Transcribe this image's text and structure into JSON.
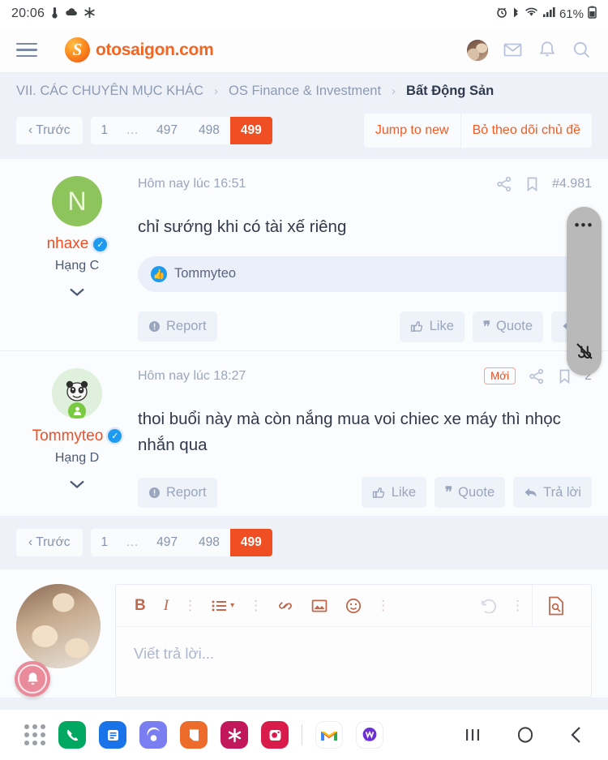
{
  "statusbar": {
    "clock": "20:06",
    "battery_pct": "61%",
    "left_icons": [
      "thermometer-icon",
      "cloud-icon",
      "snowflake-icon"
    ],
    "right_icons": [
      "alarm-icon",
      "bluetooth-icon",
      "wifi-icon",
      "signal-icon",
      "battery-icon"
    ]
  },
  "header": {
    "menu_icon": "hamburger-menu-icon",
    "logo_text": "otosaigon.com",
    "logo_mark": "otosaigon-logo-icon",
    "actions": [
      "user-avatar",
      "mail-icon",
      "bell-icon",
      "search-icon"
    ],
    "brand_color": "#f26522"
  },
  "breadcrumb": {
    "items": [
      {
        "label": "VII. CÁC CHUYÊN MỤC KHÁC",
        "current": false
      },
      {
        "label": "OS Finance & Investment",
        "current": false
      },
      {
        "label": "Bất Động Sản",
        "current": true
      }
    ],
    "separator": "›"
  },
  "pagination": {
    "prev_label": "‹ Trước",
    "pages": [
      "1",
      "…",
      "497",
      "498",
      "499"
    ],
    "active_page": "499",
    "active_color": "#f04e23",
    "actions": [
      {
        "label": "Jump to new",
        "name": "jump-to-new-button"
      },
      {
        "label": "Bỏ theo dõi chủ đề",
        "name": "unwatch-thread-button"
      }
    ]
  },
  "posts": [
    {
      "username": "nhaxe",
      "rank": "Hạng C",
      "avatar_letter": "N",
      "avatar_type": "letter-avatar",
      "avatar_color": "#8ec45c",
      "verified": true,
      "timestamp": "Hôm nay lúc 16:51",
      "post_number": "#4.981",
      "new_badge": "",
      "text": "chỉ sướng khi có tài xế riêng",
      "reaction_names": "Tommyteo",
      "reaction_icon": "thumbs-up-icon",
      "meta_icons": [
        "share-icon",
        "bookmark-icon"
      ],
      "actions": {
        "report": "Report",
        "like": "Like",
        "quote": "Quote",
        "reply": ""
      }
    },
    {
      "username": "Tommyteo",
      "rank": "Hạng D",
      "avatar_letter": "",
      "avatar_type": "panda-photo-avatar",
      "avatar_color": "#dff0dc",
      "verified": true,
      "timestamp": "Hôm nay lúc 18:27",
      "post_number": "2",
      "new_badge": "Mới",
      "text": "thoi buổi này mà còn nắng mua voi chiec xe máy thì nhọc nhắn qua",
      "reaction_names": "",
      "reaction_icon": "",
      "meta_icons": [
        "share-icon",
        "bookmark-icon"
      ],
      "actions": {
        "report": "Report",
        "like": "Like",
        "quote": "Quote",
        "reply": "Trả lời"
      }
    }
  ],
  "editor": {
    "avatar": "puppies-photo-avatar",
    "placeholder": "Viết trả lời...",
    "toolbar": [
      {
        "label": "B",
        "name": "bold-button"
      },
      {
        "label": "I",
        "name": "italic-button"
      },
      {
        "label": "⋮",
        "name": "more-text-options-icon"
      },
      {
        "label": "list",
        "name": "list-dropdown-button"
      },
      {
        "label": "⋮",
        "name": "more-list-options-icon"
      },
      {
        "label": "link",
        "name": "insert-link-button"
      },
      {
        "label": "image",
        "name": "insert-image-button"
      },
      {
        "label": "emoji",
        "name": "insert-emoji-button"
      },
      {
        "label": "⋮",
        "name": "more-insert-options-icon"
      }
    ],
    "undo_icon": "undo-icon",
    "preview_icon": "preview-document-icon"
  },
  "floating": {
    "pill_dots": "•••",
    "pill_bottom_icon": "mute-sound-icon",
    "bell_icon": "notification-bell-icon",
    "bell_color": "#e98b9a"
  },
  "dock": {
    "apps": [
      {
        "name": "app-drawer-icon",
        "glyph": "",
        "color": ""
      },
      {
        "name": "phone-app-icon",
        "glyph": "✆",
        "color": "#00a862"
      },
      {
        "name": "messages-app-icon",
        "glyph": "▤",
        "color": "#1a73e8"
      },
      {
        "name": "bixby-app-icon",
        "glyph": "◠",
        "color": "#7b7ef0"
      },
      {
        "name": "notes-app-icon",
        "glyph": "▯",
        "color": "#ed6c2b"
      },
      {
        "name": "samsung-internet-app-icon",
        "glyph": "✳",
        "color": "#c2185b"
      },
      {
        "name": "camera-app-icon",
        "glyph": "◉",
        "color": "#d81b4a"
      }
    ],
    "apps_right": [
      {
        "name": "gmail-app-icon",
        "glyph": "M",
        "color": "#ffffff"
      },
      {
        "name": "chat-app-icon",
        "glyph": "◍",
        "color": "#ffffff"
      }
    ],
    "nav": [
      {
        "name": "recents-button",
        "glyph": "|||"
      },
      {
        "name": "home-button",
        "glyph": "▢"
      },
      {
        "name": "back-button",
        "glyph": "‹"
      }
    ]
  }
}
